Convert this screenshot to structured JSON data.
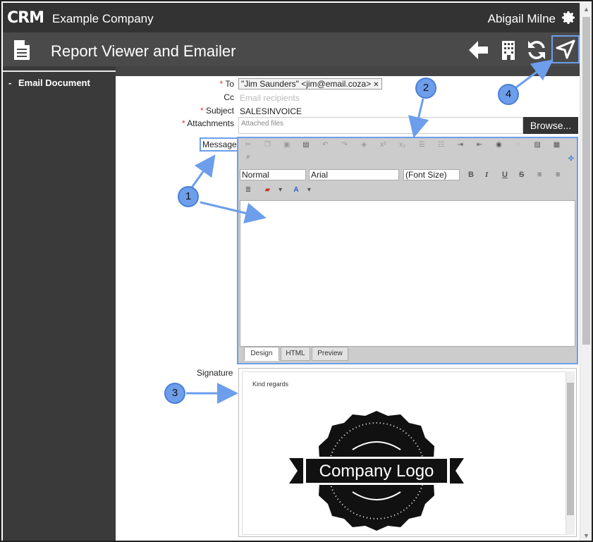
{
  "header": {
    "logo_text": "CRM",
    "company": "Example Company",
    "user": "Abigail Milne"
  },
  "titlebar": {
    "title": "Report Viewer and Emailer"
  },
  "sidebar": {
    "items": [
      {
        "label": "Email Document",
        "prefix": "-"
      }
    ]
  },
  "form": {
    "to_label": "To",
    "to_value": "\"Jim Saunders\" <jim@email.coza>",
    "cc_label": "Cc",
    "cc_placeholder": "Email recipients",
    "subject_label": "Subject",
    "subject_value": "SALESINVOICE",
    "attachments_label": "Attachments",
    "attachments_placeholder": "Attached files",
    "browse_label": "Browse...",
    "message_label": "Message",
    "signature_label": "Signature",
    "required_mark": "*"
  },
  "editor": {
    "format_value": "Normal",
    "font_value": "Arial",
    "size_value": "(Font Size)",
    "tabs": [
      "Design",
      "HTML",
      "Preview"
    ],
    "active_tab": "Design"
  },
  "signature": {
    "greeting": "Kind regards",
    "logo_text": "Company Logo"
  },
  "callouts": [
    "1",
    "2",
    "3",
    "4"
  ],
  "colors": {
    "callout": "#6d9eeb",
    "topbar": "#333333",
    "titlebar": "#4a4a4a",
    "sidebar": "#3a3a3a",
    "required": "#d9342b"
  }
}
